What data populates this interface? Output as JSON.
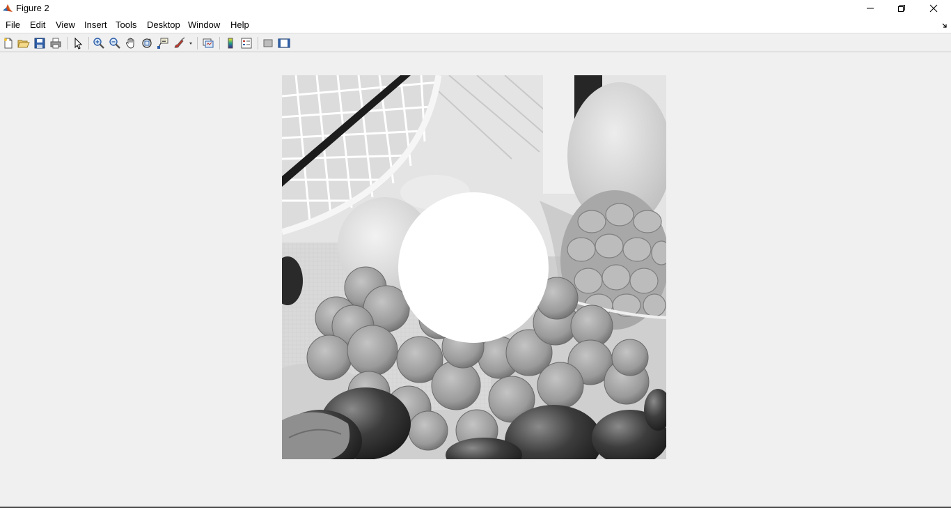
{
  "window": {
    "title": "Figure 2",
    "app_icon": "matlab-icon"
  },
  "window_controls": [
    "minimize-icon",
    "restore-icon",
    "close-icon"
  ],
  "menu": {
    "items": [
      "File",
      "Edit",
      "View",
      "Insert",
      "Tools",
      "Desktop",
      "Window",
      "Help"
    ]
  },
  "toolbar": {
    "buttons": [
      "new-figure-icon",
      "open-file-icon",
      "save-icon",
      "print-icon",
      "edit-plot-arrow-icon",
      "zoom-in-icon",
      "zoom-out-icon",
      "pan-hand-icon",
      "rotate-3d-icon",
      "data-cursor-icon",
      "brush-icon",
      "link-plot-icon",
      "insert-colorbar-icon",
      "insert-legend-icon",
      "hide-plot-tools-icon",
      "show-plot-tools-icon"
    ]
  },
  "figure": {
    "content": "grayscale fruit photograph with white circular mask",
    "mask_color": "#ffffff",
    "background_color": "#f0f0f0"
  }
}
